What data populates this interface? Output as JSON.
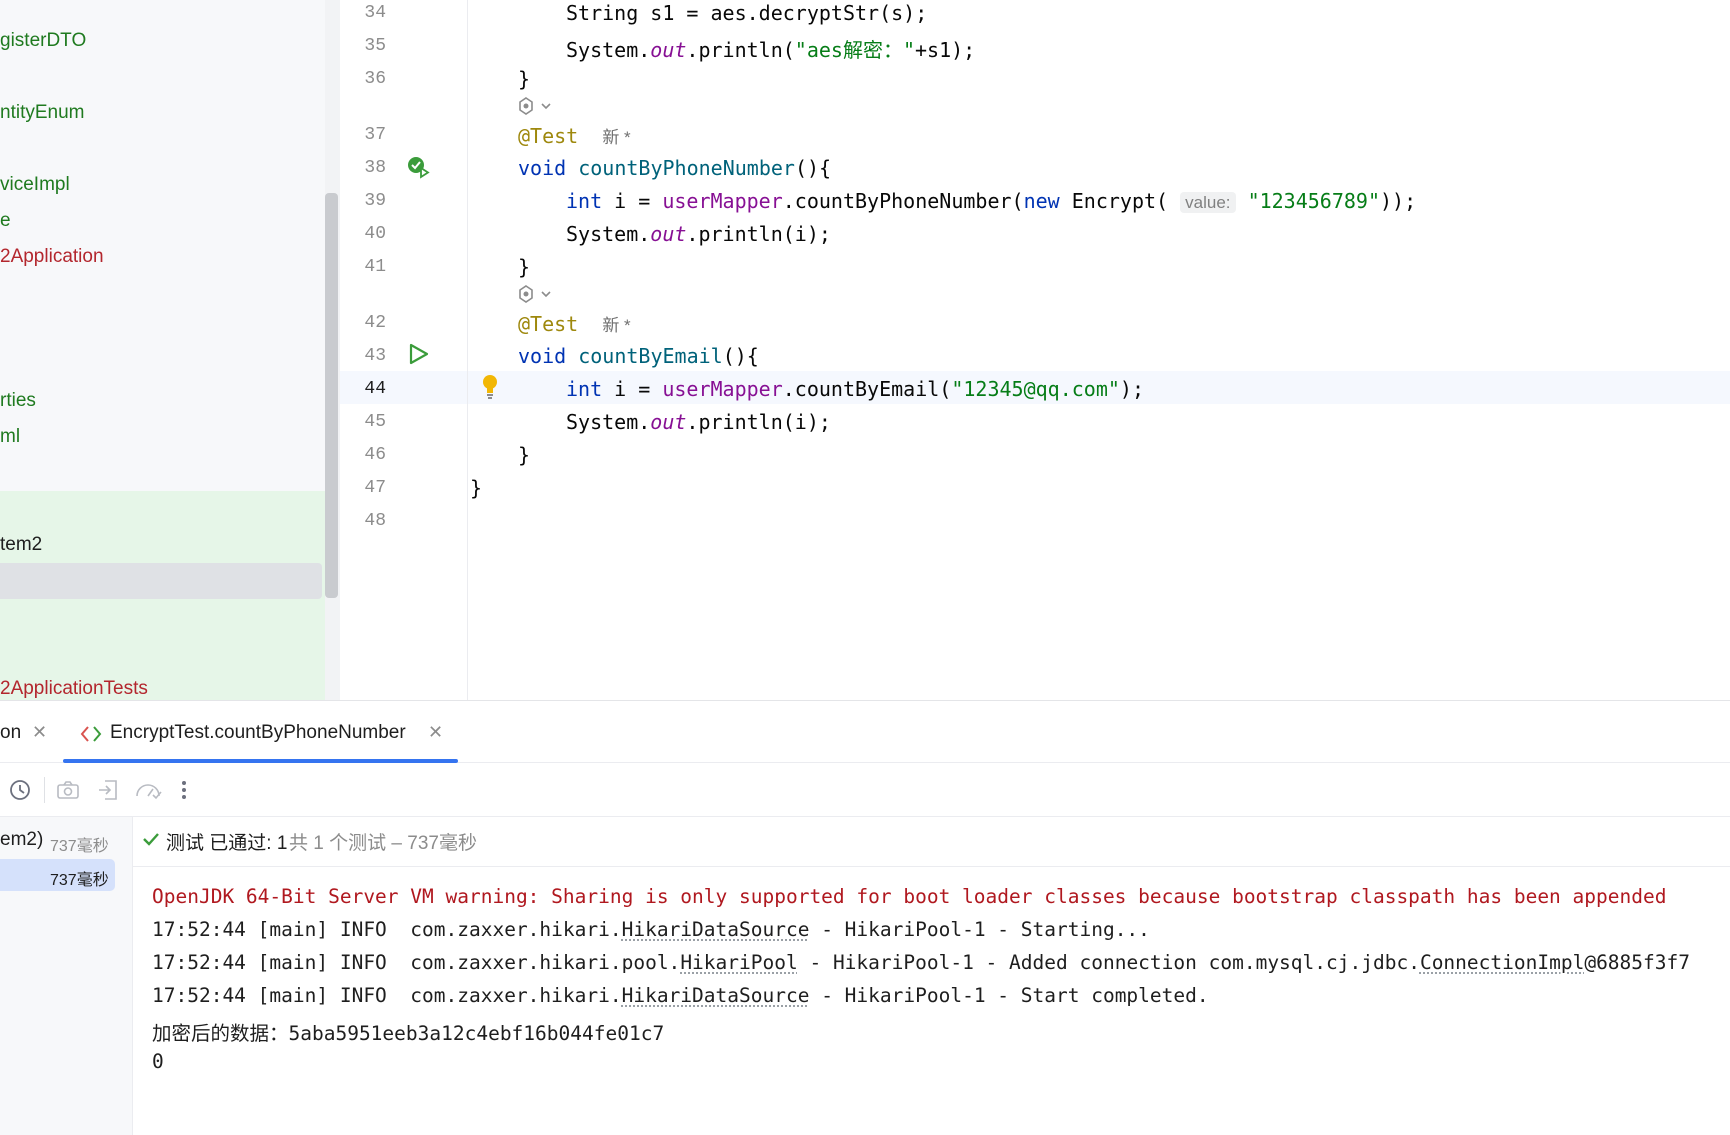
{
  "project_tree": {
    "items": [
      {
        "label": "gisterDTO",
        "color": "green"
      },
      {
        "label": "ntityEnum",
        "color": "green"
      },
      {
        "label": "viceImpl",
        "color": "green"
      },
      {
        "label": "e",
        "color": "green"
      },
      {
        "label": "2Application",
        "color": "red"
      },
      {
        "label": "rties",
        "color": "green"
      },
      {
        "label": "ml",
        "color": "green"
      },
      {
        "label": "tem2",
        "color": "black"
      },
      {
        "label": "2ApplicationTests",
        "color": "red"
      }
    ]
  },
  "editor": {
    "line_numbers": [
      "34",
      "35",
      "36",
      "37",
      "38",
      "39",
      "40",
      "41",
      "42",
      "43",
      "44",
      "45",
      "46",
      "47",
      "48"
    ],
    "current_line": "44",
    "code": {
      "l34": "String s1 = aes.decryptStr(s);",
      "l35_a": "System.",
      "l35_b": "out",
      "l35_c": ".println(",
      "l35_d": "\"aes解密：\"",
      "l35_e": "+s1);",
      "l36": "}",
      "l37_ann": "@Test",
      "l37_badge": "新 *",
      "l38_kw": "void",
      "l38_fn": "countByPhoneNumber",
      "l38_rest": "(){",
      "l39_kw": "int",
      "l39_a": " i = ",
      "l39_fld": "userMapper",
      "l39_b": ".countByPhoneNumber(",
      "l39_new": "new",
      "l39_c": " Encrypt(",
      "l39_hint": "value:",
      "l39_str": "\"123456789\"",
      "l39_d": "));",
      "l40_a": "System.",
      "l40_b": "out",
      "l40_c": ".println(i);",
      "l41": "}",
      "l42_ann": "@Test",
      "l42_badge": "新 *",
      "l43_kw": "void",
      "l43_fn": "countByEmail",
      "l43_rest": "(){",
      "l44_kw": "int",
      "l44_a": " i = ",
      "l44_fld": "userMapper",
      "l44_b": ".countByEmail(",
      "l44_str": "\"12345@qq.com\"",
      "l44_c": ");",
      "l45_a": "System.",
      "l45_b": "out",
      "l45_c": ".println(i);",
      "l46": "}",
      "l47": "}"
    }
  },
  "run_panel": {
    "tabs": [
      {
        "label": "on"
      },
      {
        "label": "EncryptTest.countByPhoneNumber",
        "active": true
      }
    ],
    "toolbar_icons": [
      "history-icon",
      "camera-icon",
      "import-icon",
      "coverage-icon",
      "more-icon"
    ],
    "test_tree": {
      "root_label": "em2)",
      "root_time": "737毫秒",
      "child_time": "737毫秒"
    },
    "status": {
      "passed_text": "测试 已通过: 1",
      "count_text": "共 1 个测试 – 737毫秒"
    },
    "console": {
      "warning": "OpenJDK 64-Bit Server VM warning: Sharing is only supported for boot loader classes because bootstrap classpath has been appended",
      "l1_a": "17:52:44 [main] INFO  com.zaxxer.hikari.",
      "l1_b": "HikariDataSource",
      "l1_c": " - HikariPool-1 - Starting...",
      "l2_a": "17:52:44 [main] INFO  com.zaxxer.hikari.pool.",
      "l2_b": "HikariPool",
      "l2_c": " - HikariPool-1 - Added connection com.mysql.cj.jdbc.",
      "l2_d": "ConnectionImpl",
      "l2_e": "@6885f3f7",
      "l3_a": "17:52:44 [main] INFO  com.zaxxer.hikari.",
      "l3_b": "HikariDataSource",
      "l3_c": " - HikariPool-1 - Start completed.",
      "l4": "加密后的数据：5aba5951eeb3a12c4ebf16b044fe01c7",
      "l5": "0"
    }
  },
  "colors": {
    "keyword": "#0033b3",
    "method": "#00627a",
    "field": "#871094",
    "string": "#067d17",
    "annotation": "#9e880d",
    "error": "#b0181f",
    "pass": "#3b9c3b",
    "accent": "#3574f0"
  }
}
